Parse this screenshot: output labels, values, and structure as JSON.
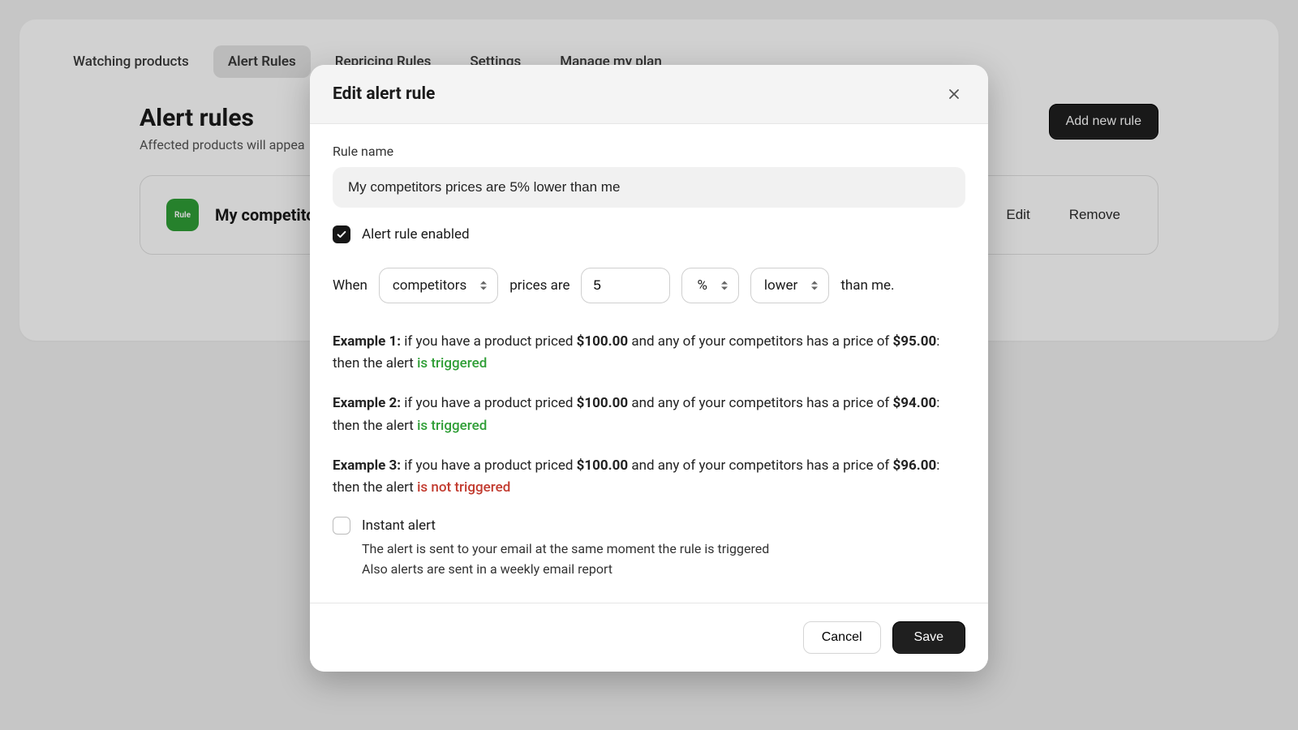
{
  "tabs": {
    "watching": "Watching products",
    "alert_rules": "Alert Rules",
    "repricing": "Repricing Rules",
    "settings": "Settings",
    "manage_plan": "Manage my plan"
  },
  "page": {
    "title": "Alert rules",
    "subtitle_prefix": "Affected products will appea",
    "add_button": "Add new rule"
  },
  "rule_item": {
    "badge": "Rule",
    "title_prefix": "My competitors",
    "edit": "Edit",
    "remove": "Remove"
  },
  "modal": {
    "title": "Edit alert rule",
    "rule_name_label": "Rule name",
    "rule_name_value": "My competitors prices are 5% lower than me",
    "enabled_label": "Alert rule enabled",
    "enabled_checked": true,
    "sentence": {
      "when": "When",
      "who": "competitors",
      "prices_are": "prices are",
      "value": "5",
      "unit": "%",
      "direction": "lower",
      "than_me": "than me."
    },
    "examples": {
      "e1_label": "Example 1:",
      "e1_a": " if you have a product priced ",
      "e1_p1": "$100.00",
      "e1_b": " and any of your competitors has a price of ",
      "e1_p2": "$95.00",
      "e1_c": ": then the alert ",
      "e1_r": "is triggered",
      "e2_label": "Example 2:",
      "e2_a": " if you have a product priced ",
      "e2_p1": "$100.00",
      "e2_b": " and any of your competitors has a price of ",
      "e2_p2": "$94.00",
      "e2_c": ": then the alert ",
      "e2_r": "is triggered",
      "e3_label": "Example 3:",
      "e3_a": " if you have a product priced ",
      "e3_p1": "$100.00",
      "e3_b": " and any of your competitors has a price of ",
      "e3_p2": "$96.00",
      "e3_c": ": then the alert ",
      "e3_r": "is not triggered"
    },
    "instant": {
      "label": "Instant alert",
      "checked": false,
      "line1": "The alert is sent to your email at the same moment the rule is triggered",
      "line2": "Also alerts are sent in a weekly email report"
    },
    "footer": {
      "cancel": "Cancel",
      "save": "Save"
    }
  }
}
